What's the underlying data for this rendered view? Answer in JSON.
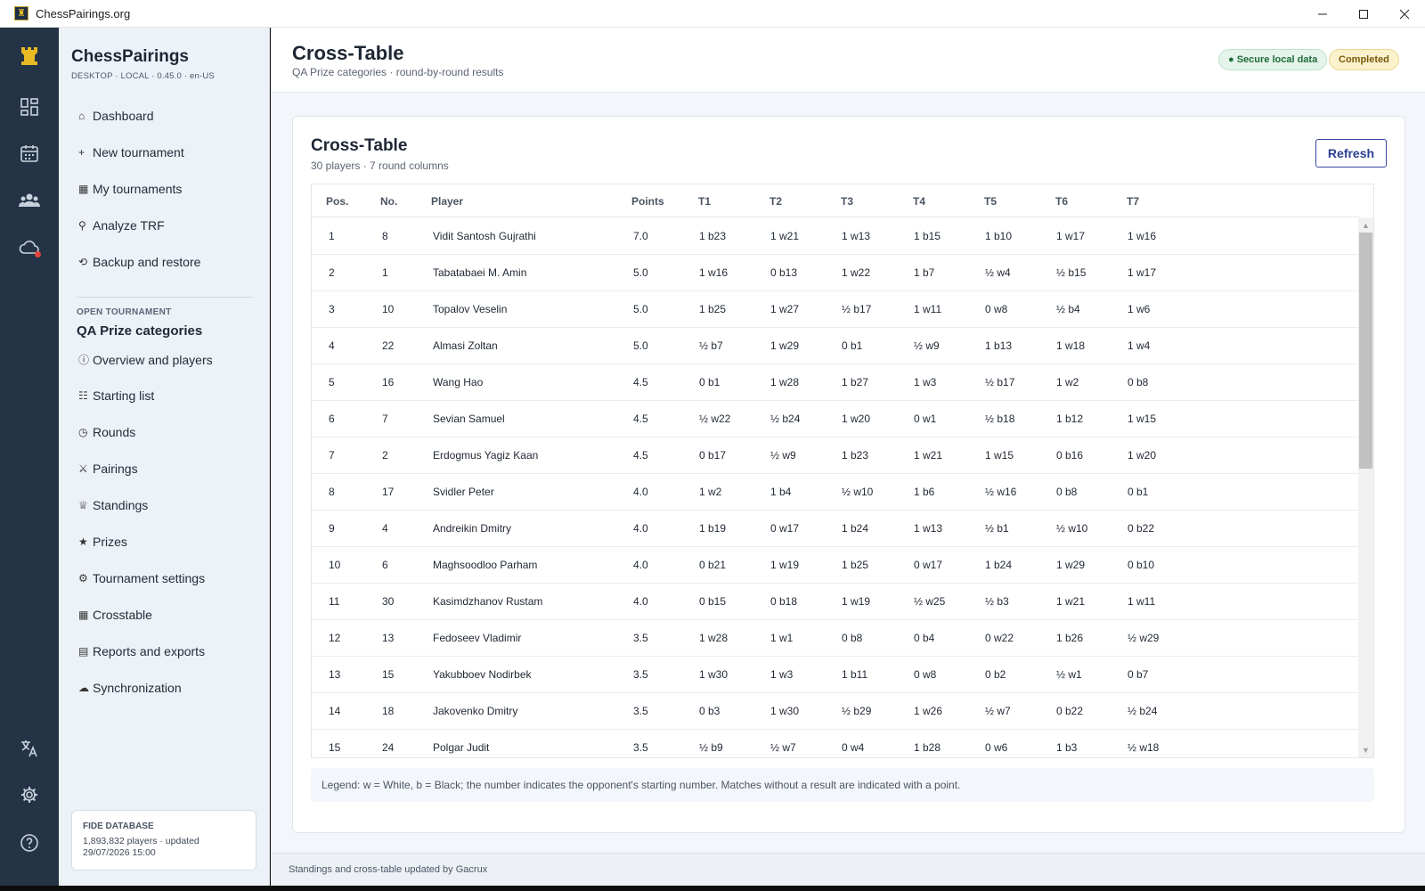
{
  "window": {
    "title": "ChessPairings.org"
  },
  "brand": {
    "name": "ChessPairings",
    "subtitle": "DESKTOP · LOCAL · 0.45.0 · en-US"
  },
  "nav": [
    {
      "glyph": "⌂",
      "label": "Dashboard",
      "icon": "home-icon"
    },
    {
      "glyph": "+",
      "label": "New tournament",
      "icon": "plus-icon"
    },
    {
      "glyph": "▦",
      "label": "My tournaments",
      "icon": "grid-icon"
    },
    {
      "glyph": "⚲",
      "label": "Analyze TRF",
      "icon": "search-icon"
    },
    {
      "glyph": "⟲",
      "label": "Backup and restore",
      "icon": "restore-icon"
    }
  ],
  "open_tournament": {
    "label": "OPEN TOURNAMENT",
    "name": "QA Prize categories",
    "items": [
      {
        "glyph": "ⓘ",
        "label": "Overview and players",
        "icon": "info-icon"
      },
      {
        "glyph": "☷",
        "label": "Starting list",
        "icon": "list-icon"
      },
      {
        "glyph": "◷",
        "label": "Rounds",
        "icon": "clock-icon"
      },
      {
        "glyph": "⚔",
        "label": "Pairings",
        "icon": "swords-icon"
      },
      {
        "glyph": "♕",
        "label": "Standings",
        "icon": "crown-icon"
      },
      {
        "glyph": "★",
        "label": "Prizes",
        "icon": "star-icon"
      },
      {
        "glyph": "⚙",
        "label": "Tournament settings",
        "icon": "gear-icon"
      },
      {
        "glyph": "▦",
        "label": "Crosstable",
        "icon": "table-icon"
      },
      {
        "glyph": "▤",
        "label": "Reports and exports",
        "icon": "report-icon"
      },
      {
        "glyph": "☁",
        "label": "Synchronization",
        "icon": "cloud-icon"
      }
    ]
  },
  "fide": {
    "title": "FIDE DATABASE",
    "line1": "1,893,832 players · updated",
    "line2": "29/07/2026 15:00"
  },
  "header": {
    "title": "Cross-Table",
    "subtitle": "QA Prize categories · round-by-round results",
    "badge_secure": "● Secure local data",
    "badge_status": "Completed"
  },
  "card": {
    "title": "Cross-Table",
    "subtitle": "30 players · 7 round columns",
    "refresh_label": "Refresh"
  },
  "table": {
    "columns": [
      "Pos.",
      "No.",
      "Player",
      "Points",
      "T1",
      "T2",
      "T3",
      "T4",
      "T5",
      "T6",
      "T7"
    ],
    "rows": [
      [
        "1",
        "8",
        "Vidit Santosh Gujrathi",
        "7.0",
        "1 b23",
        "1 w21",
        "1 w13",
        "1 b15",
        "1 b10",
        "1 w17",
        "1 w16"
      ],
      [
        "2",
        "1",
        "Tabatabaei M. Amin",
        "5.0",
        "1 w16",
        "0 b13",
        "1 w22",
        "1 b7",
        "½ w4",
        "½ b15",
        "1 w17"
      ],
      [
        "3",
        "10",
        "Topalov Veselin",
        "5.0",
        "1 b25",
        "1 w27",
        "½ b17",
        "1 w11",
        "0 w8",
        "½ b4",
        "1 w6"
      ],
      [
        "4",
        "22",
        "Almasi Zoltan",
        "5.0",
        "½ b7",
        "1 w29",
        "0 b1",
        "½ w9",
        "1 b13",
        "1 w18",
        "1 w4"
      ],
      [
        "5",
        "16",
        "Wang Hao",
        "4.5",
        "0 b1",
        "1 w28",
        "1 b27",
        "1 w3",
        "½ b17",
        "1 w2",
        "0 b8"
      ],
      [
        "6",
        "7",
        "Sevian Samuel",
        "4.5",
        "½ w22",
        "½ b24",
        "1 w20",
        "0 w1",
        "½ b18",
        "1 b12",
        "1 w15"
      ],
      [
        "7",
        "2",
        "Erdogmus Yagiz Kaan",
        "4.5",
        "0 b17",
        "½ w9",
        "1 b23",
        "1 w21",
        "1 w15",
        "0 b16",
        "1 w20"
      ],
      [
        "8",
        "17",
        "Svidler Peter",
        "4.0",
        "1 w2",
        "1 b4",
        "½ w10",
        "1 b6",
        "½ w16",
        "0 b8",
        "0 b1"
      ],
      [
        "9",
        "4",
        "Andreikin Dmitry",
        "4.0",
        "1 b19",
        "0 w17",
        "1 b24",
        "1 w13",
        "½ b1",
        "½ w10",
        "0 b22"
      ],
      [
        "10",
        "6",
        "Maghsoodloo Parham",
        "4.0",
        "0 b21",
        "1 w19",
        "1 b25",
        "0 w17",
        "1 b24",
        "1 w29",
        "0 b10"
      ],
      [
        "11",
        "30",
        "Kasimdzhanov Rustam",
        "4.0",
        "0 b15",
        "0 b18",
        "1 w19",
        "½ w25",
        "½ b3",
        "1 w21",
        "1 w11"
      ],
      [
        "12",
        "13",
        "Fedoseev Vladimir",
        "3.5",
        "1 w28",
        "1 w1",
        "0 b8",
        "0 b4",
        "0 w22",
        "1 b26",
        "½ w29"
      ],
      [
        "13",
        "15",
        "Yakubboev Nodirbek",
        "3.5",
        "1 w30",
        "1 w3",
        "1 b11",
        "0 w8",
        "0 b2",
        "½ w1",
        "0 b7"
      ],
      [
        "14",
        "18",
        "Jakovenko Dmitry",
        "3.5",
        "0 b3",
        "1 w30",
        "½ b29",
        "1 w26",
        "½ w7",
        "0 b22",
        "½ b24"
      ],
      [
        "15",
        "24",
        "Polgar Judit",
        "3.5",
        "½ b9",
        "½ w7",
        "0 w4",
        "1 b28",
        "0 w6",
        "1 b3",
        "½ w18"
      ]
    ]
  },
  "legend": "Legend: w = White, b = Black; the number indicates the opponent's starting number. Matches without a result are indicated with a point.",
  "footer": "Standings and cross-table updated by Gacrux",
  "colors": {
    "rail": "#243446",
    "sidebar": "#edf2f8",
    "accent": "#2c3f92",
    "logo": "#e8b923"
  }
}
